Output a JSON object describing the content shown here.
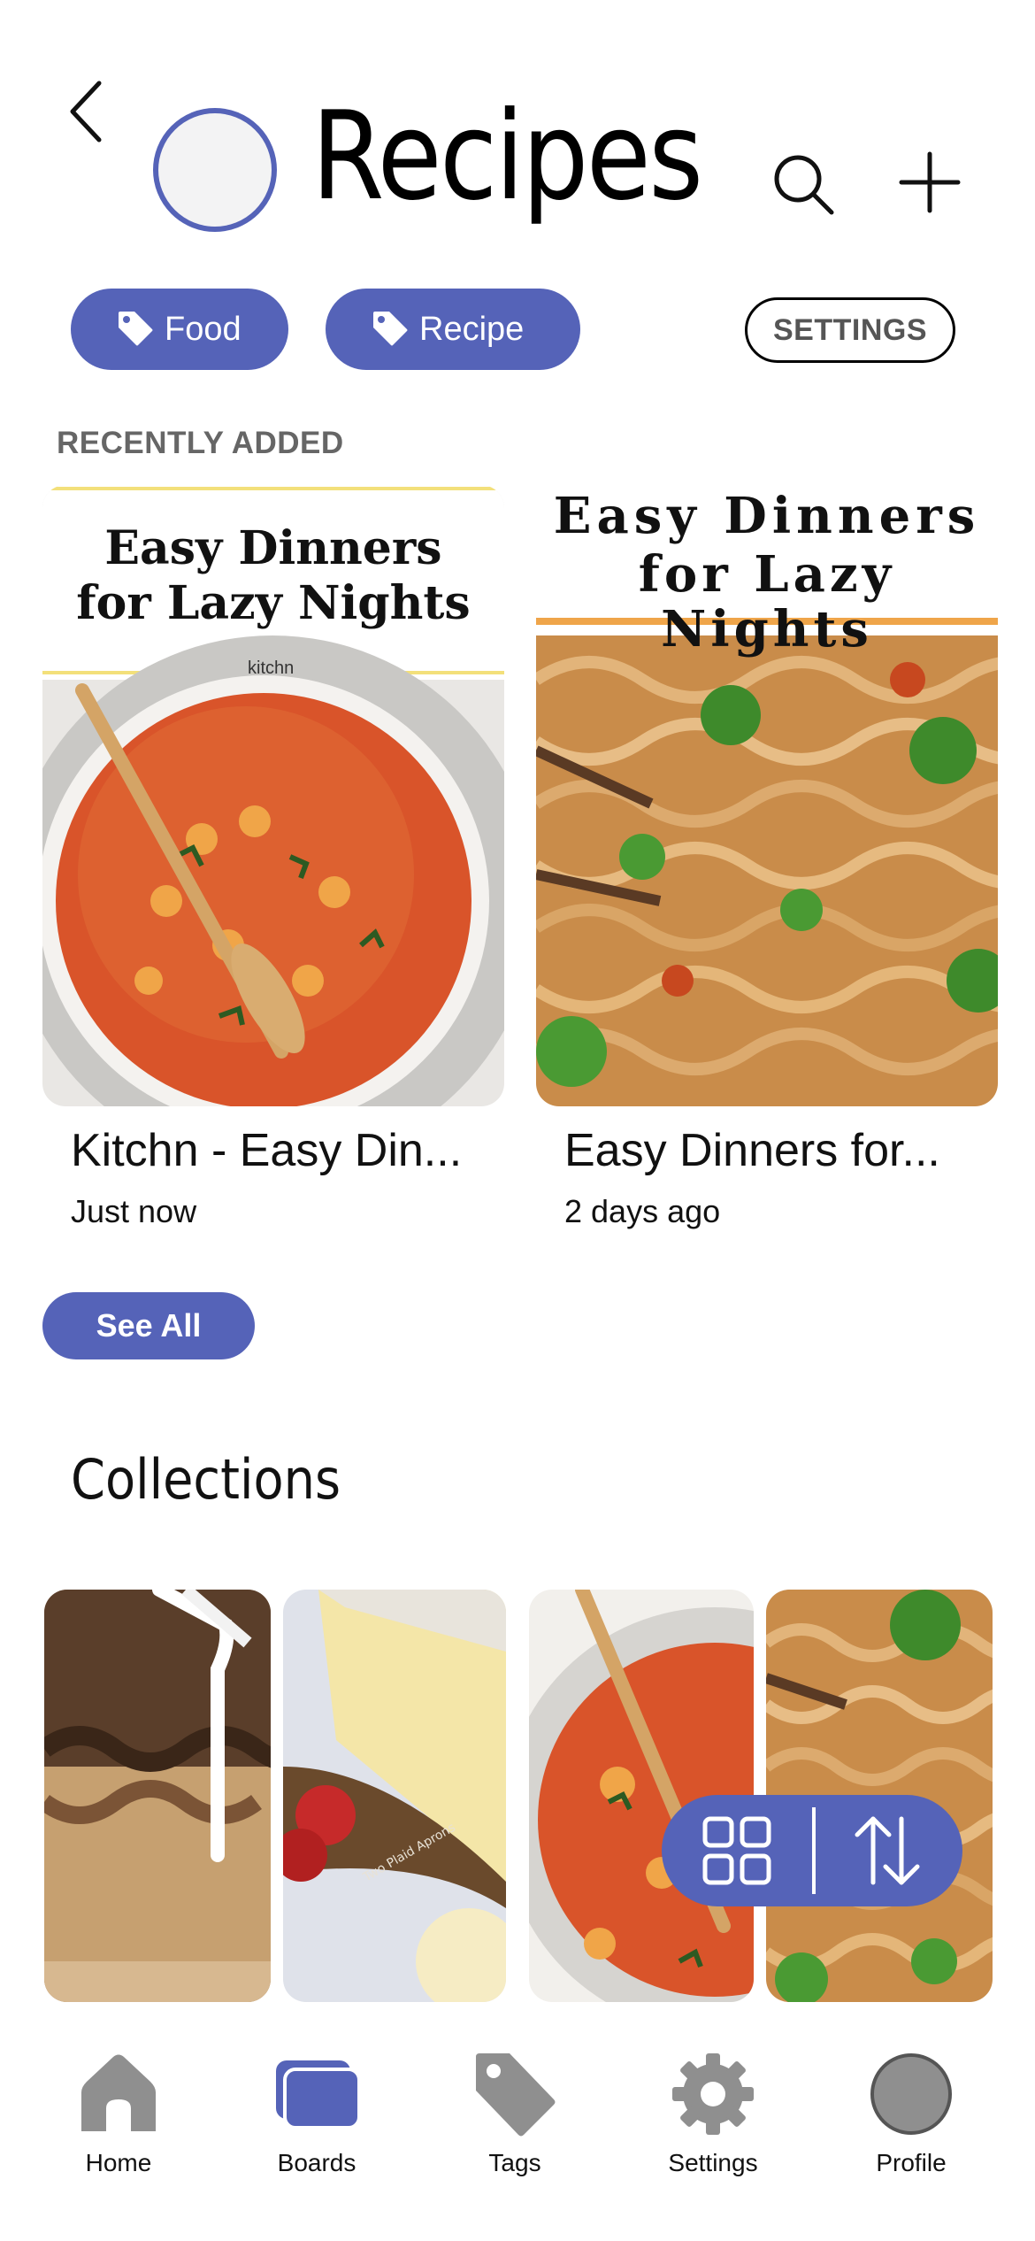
{
  "header": {
    "title": "Recipes"
  },
  "tags": [
    {
      "label": "Food"
    },
    {
      "label": "Recipe"
    }
  ],
  "settings_button": "SETTINGS",
  "recently_added": {
    "heading": "RECENTLY ADDED",
    "items": [
      {
        "title": "Kitchn - Easy Din...",
        "time": "Just now",
        "banner_line1": "Easy Dinners",
        "banner_line2": "for Lazy Nights",
        "brand": "kitchn"
      },
      {
        "title": "Easy Dinners for...",
        "time": "2 days ago",
        "banner_line1": "Easy Dinners",
        "banner_line2": "for Lazy Nights"
      }
    ],
    "see_all": "See All"
  },
  "collections": {
    "heading": "Collections",
    "thumb_caption": "Two Plaid Aprons"
  },
  "bottom_nav": [
    {
      "label": "Home",
      "icon": "home-icon"
    },
    {
      "label": "Boards",
      "icon": "boards-icon"
    },
    {
      "label": "Tags",
      "icon": "tag-icon"
    },
    {
      "label": "Settings",
      "icon": "gear-icon"
    },
    {
      "label": "Profile",
      "icon": "profile-icon"
    }
  ],
  "colors": {
    "accent": "#5563b8",
    "nav_inactive": "#8f8f8f",
    "section_label": "#666666"
  }
}
